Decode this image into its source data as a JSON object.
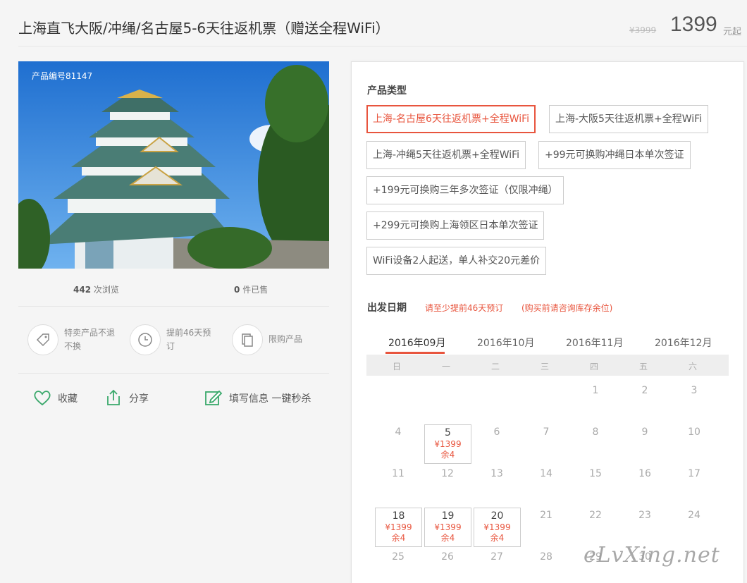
{
  "header": {
    "title": "上海直飞大阪/冲绳/名古屋5-6天往返机票（赠送全程WiFi）",
    "old_price": "¥3999",
    "price": "1399",
    "price_unit": "元起"
  },
  "gallery": {
    "product_no": "产品编号81147"
  },
  "stats": {
    "views_count": "442",
    "views_label": "次浏览",
    "sold_count": "0",
    "sold_label": "件已售"
  },
  "features": [
    {
      "icon": "price-tag-icon",
      "text": "特卖产品不退不换"
    },
    {
      "icon": "clock-icon",
      "text": "提前46天预订"
    },
    {
      "icon": "copy-icon",
      "text": "限购产品"
    }
  ],
  "actions": {
    "favorite": "收藏",
    "share": "分享",
    "fill_info": "填写信息 一键秒杀"
  },
  "product_type": {
    "title": "产品类型",
    "options": [
      "上海-名古屋6天往返机票+全程WiFi",
      "上海-大阪5天往返机票+全程WiFi",
      "上海-冲绳5天往返机票+全程WiFi",
      "+99元可换购冲绳日本单次签证",
      "+199元可换购三年多次签证（仅限冲绳）",
      "+299元可换购上海领区日本单次签证",
      "WiFi设备2人起送，单人补交20元差价"
    ],
    "selected": 0
  },
  "departure": {
    "title": "出发日期",
    "hint1": "请至少提前46天预订",
    "hint2": "(购买前请咨询库存余位)",
    "months": [
      "2016年09月",
      "2016年10月",
      "2016年11月",
      "2016年12月"
    ],
    "active_month": 0,
    "weekdays": [
      "日",
      "一",
      "二",
      "三",
      "四",
      "五",
      "六"
    ],
    "days": [
      "1",
      "2",
      "3",
      "4",
      "6",
      "7",
      "8",
      "9",
      "10",
      "11",
      "12",
      "13",
      "14",
      "15",
      "16",
      "17",
      "21",
      "22",
      "23",
      "24",
      "25",
      "26",
      "27",
      "28",
      "29",
      "30"
    ],
    "available": [
      {
        "day": "5",
        "price": "¥1399",
        "remain": "余4"
      },
      {
        "day": "18",
        "price": "¥1399",
        "remain": "余4"
      },
      {
        "day": "19",
        "price": "¥1399",
        "remain": "余4"
      },
      {
        "day": "20",
        "price": "¥1399",
        "remain": "余4"
      }
    ]
  },
  "watermark": "eLvXing.net"
}
